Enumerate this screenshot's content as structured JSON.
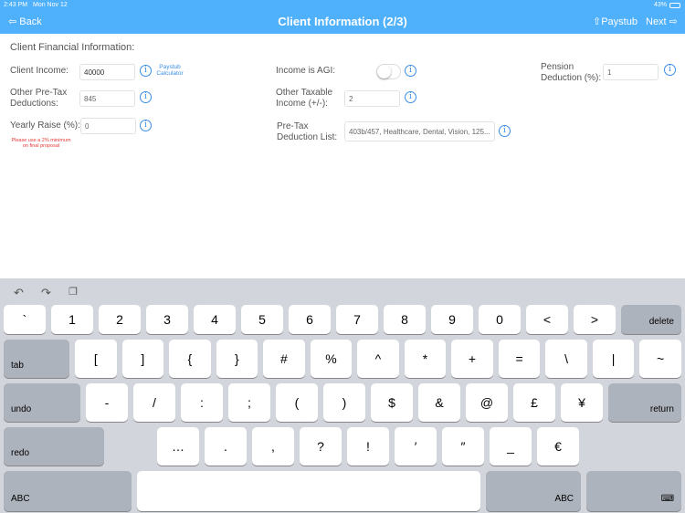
{
  "status": {
    "time": "2:43 PM",
    "date": "Mon Nov 12",
    "battery": "43%"
  },
  "nav": {
    "back": "⇦ Back",
    "title": "Client Information (2/3)",
    "paystub": "⇧Paystub",
    "next": "Next ⇨"
  },
  "section_title": "Client Financial Information:",
  "fields": {
    "client_income": {
      "label": "Client Income:",
      "value": "40000"
    },
    "paystub_calc": "Paystub Calculator",
    "other_pretax": {
      "label": "Other Pre-Tax Deductions:",
      "value": "845"
    },
    "yearly_raise": {
      "label": "Yearly Raise (%):",
      "value": "0"
    },
    "raise_warning": "Please use a 2% minimum on final proposal",
    "income_agi": {
      "label": "Income is AGI:",
      "on": false
    },
    "other_taxable": {
      "label": "Other Taxable Income (+/-):",
      "value": "2"
    },
    "pretax_list": {
      "label": "Pre-Tax Deduction List:",
      "value": "403b/457, Healthcare, Dental, Vision, 125..."
    },
    "pension": {
      "label": "Pension Deduction (%):",
      "value": "1"
    }
  },
  "info_glyph": "i",
  "toolbar": {
    "undo": "↶",
    "redo": "↷",
    "paste": "❐"
  },
  "keyboard": {
    "rows": [
      [
        "`",
        "1",
        "2",
        "3",
        "4",
        "5",
        "6",
        "7",
        "8",
        "9",
        "0",
        "<",
        ">"
      ],
      [
        "[",
        "]",
        "{",
        "}",
        "#",
        "%",
        "^",
        "*",
        "+",
        "=",
        "\\",
        "|",
        "~"
      ],
      [
        "-",
        "/",
        ":",
        ";",
        "(",
        ")",
        "$",
        "&",
        "@",
        "£",
        "¥"
      ],
      [
        "…",
        ".",
        ",",
        "?",
        "!",
        "′",
        "″",
        "_",
        "€"
      ]
    ],
    "delete": "delete",
    "tab": "tab",
    "undo": "undo",
    "return": "return",
    "redo": "redo",
    "abc": "ABC",
    "hide": "⌨"
  }
}
